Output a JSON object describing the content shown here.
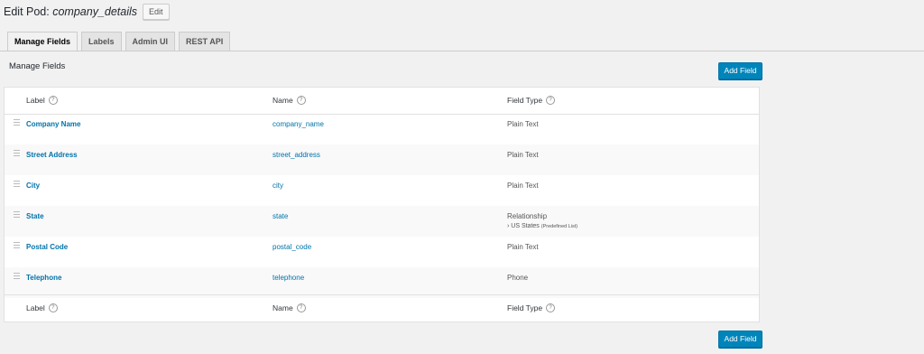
{
  "header": {
    "title_prefix": "Edit Pod:",
    "pod_name": "company_details",
    "edit_label": "Edit"
  },
  "tabs": [
    {
      "label": "Manage Fields",
      "active": true
    },
    {
      "label": "Labels"
    },
    {
      "label": "Admin UI"
    },
    {
      "label": "REST API"
    }
  ],
  "section": {
    "title": "Manage Fields",
    "add_label": "Add Field"
  },
  "columns": {
    "label": "Label",
    "name": "Name",
    "type": "Field Type",
    "help": "?"
  },
  "fields": [
    {
      "label": "Company Name",
      "name": "company_name",
      "type": "Plain Text"
    },
    {
      "label": "Street Address",
      "name": "street_address",
      "type": "Plain Text"
    },
    {
      "label": "City",
      "name": "city",
      "type": "Plain Text"
    },
    {
      "label": "State",
      "name": "state",
      "type": "Relationship",
      "sub": "› US States",
      "sub_note": "(Predefined List)"
    },
    {
      "label": "Postal Code",
      "name": "postal_code",
      "type": "Plain Text"
    },
    {
      "label": "Telephone",
      "name": "telephone",
      "type": "Phone"
    }
  ],
  "colors": {
    "accent": "#0073aa",
    "button": "#0085ba"
  }
}
